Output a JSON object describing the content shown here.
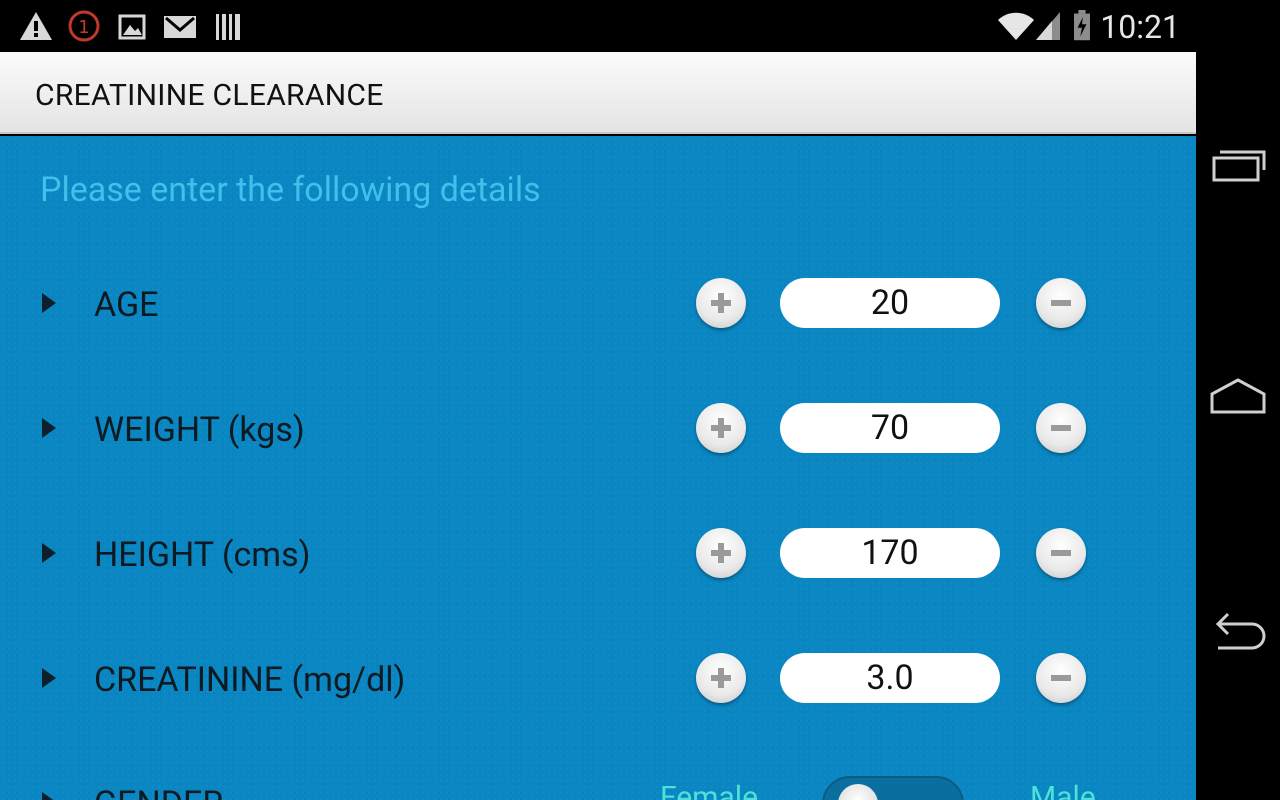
{
  "status_bar": {
    "time": "10:21",
    "icons": [
      "warning-icon",
      "notification-count-icon",
      "image-icon",
      "gmail-icon",
      "barcode-icon",
      "wifi-icon",
      "signal-icon",
      "battery-charging-icon"
    ],
    "notification_count": "1"
  },
  "action_bar": {
    "title": "CREATININE CLEARANCE"
  },
  "form": {
    "subtitle": "Please enter the following details",
    "rows": [
      {
        "label": "AGE",
        "value": "20"
      },
      {
        "label": "WEIGHT (kgs)",
        "value": "70"
      },
      {
        "label": "HEIGHT (cms)",
        "value": "170"
      },
      {
        "label": "CREATININE (mg/dl)",
        "value": "3.0"
      }
    ],
    "gender": {
      "label": "GENDER",
      "left_option": "Female",
      "right_option": "Male"
    }
  },
  "nav": [
    "recent-apps-icon",
    "home-icon",
    "back-icon"
  ],
  "colors": {
    "content_bg": "#0a86c2",
    "subtitle": "#41c0ec",
    "toggle_text": "#4fe0d8"
  }
}
